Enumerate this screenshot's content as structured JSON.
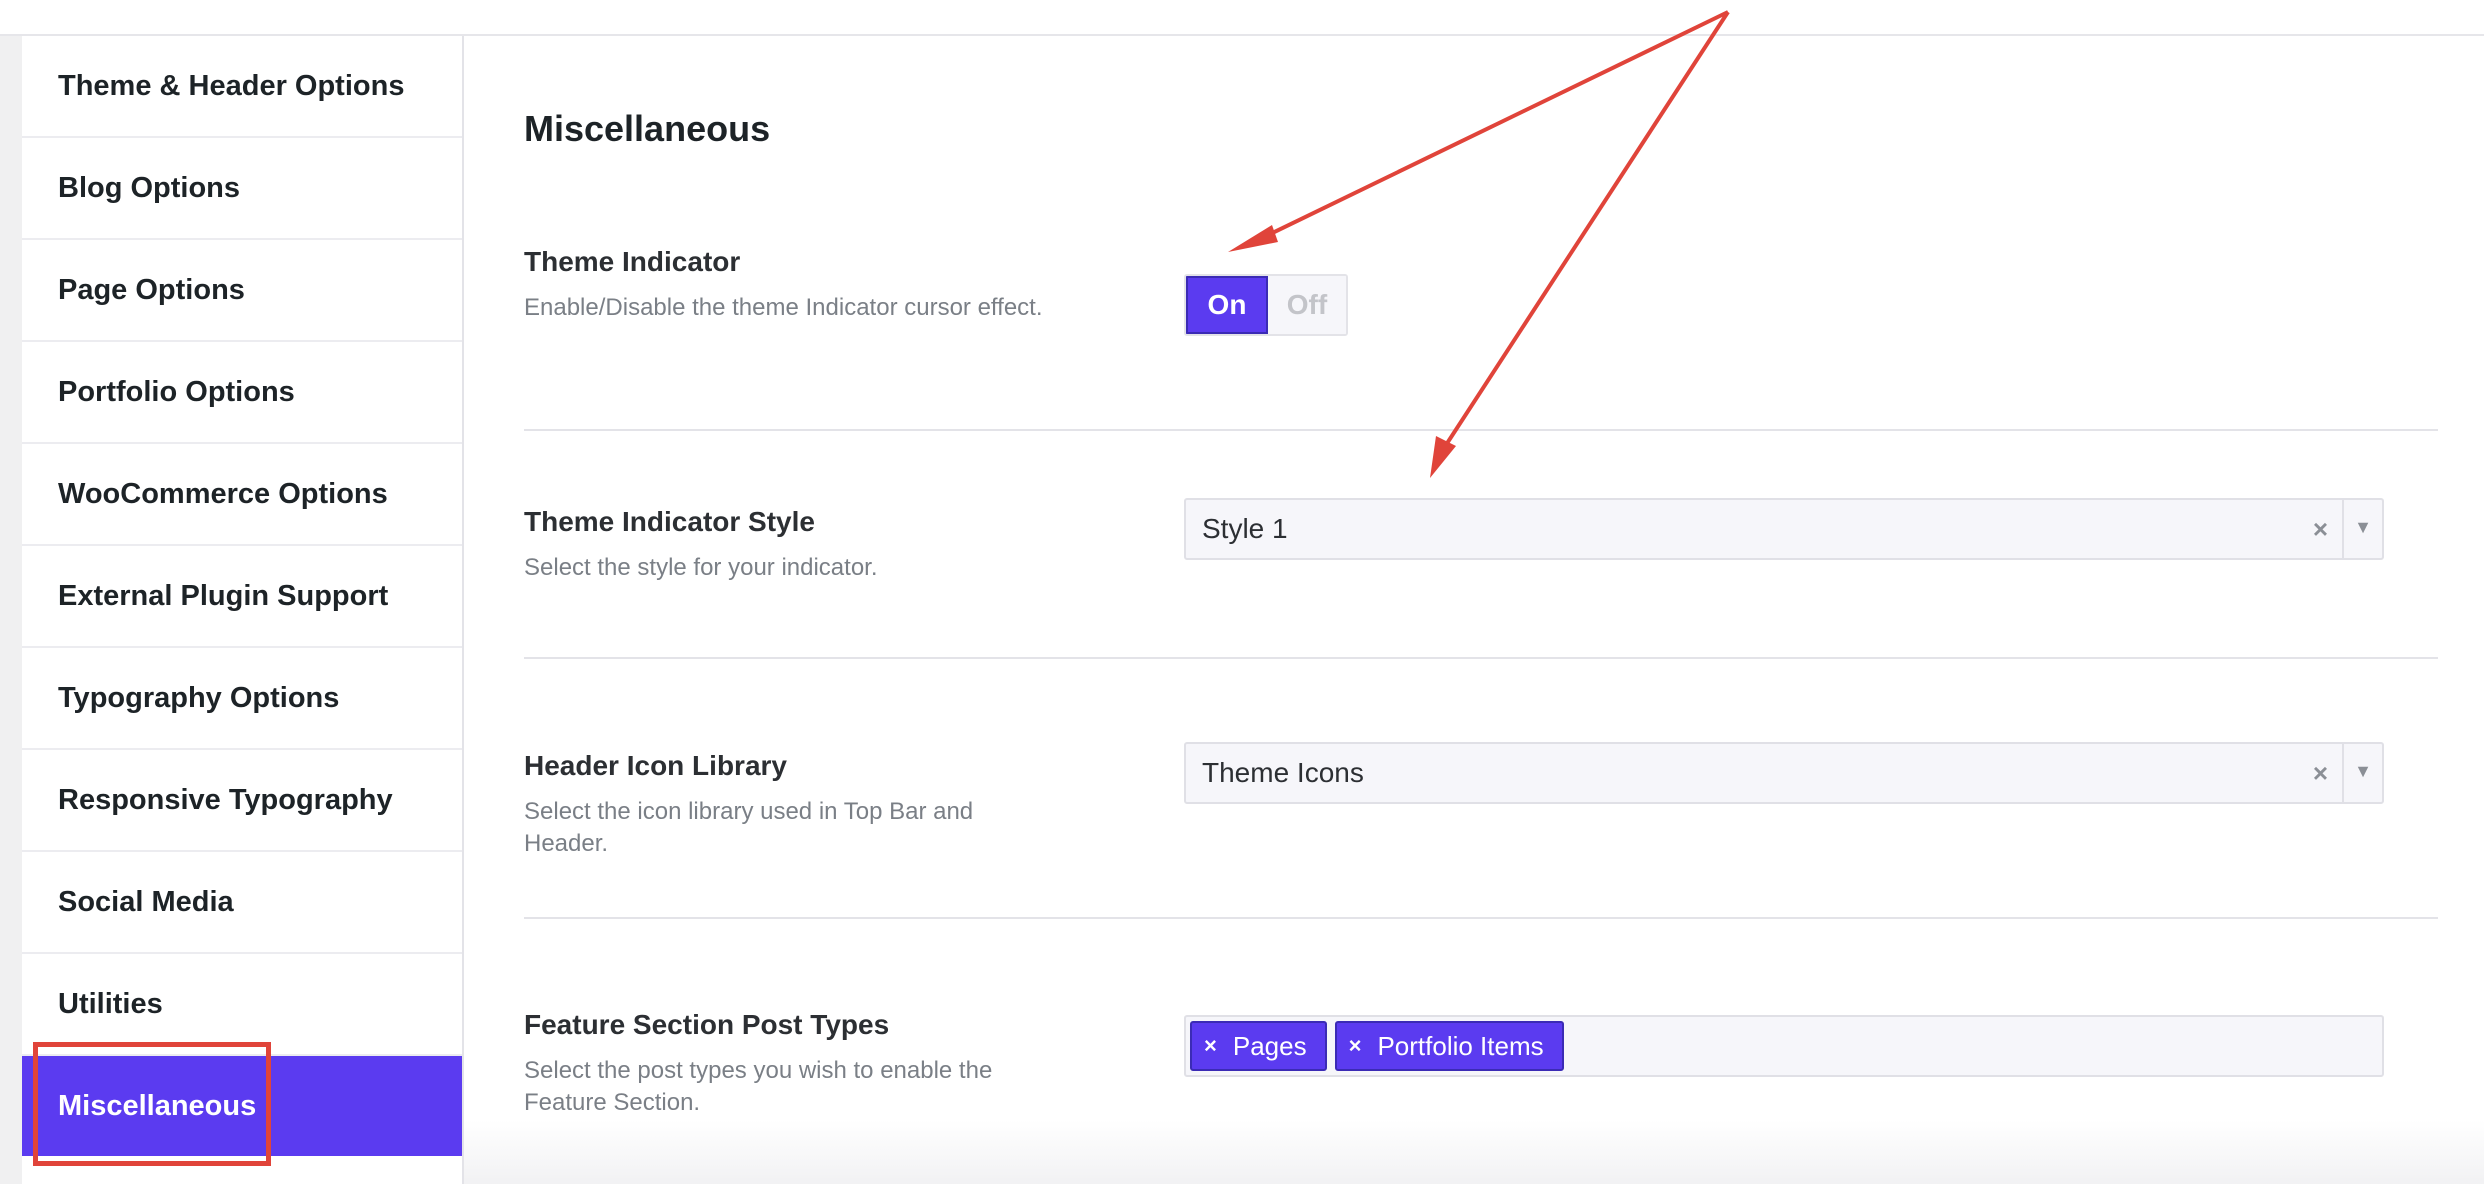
{
  "sidebar": {
    "items": [
      {
        "label": "Theme & Header Options"
      },
      {
        "label": "Blog Options"
      },
      {
        "label": "Page Options"
      },
      {
        "label": "Portfolio Options"
      },
      {
        "label": "WooCommerce Options"
      },
      {
        "label": "External Plugin Support"
      },
      {
        "label": "Typography Options"
      },
      {
        "label": "Responsive Typography"
      },
      {
        "label": "Social Media"
      },
      {
        "label": "Utilities"
      },
      {
        "label": "Miscellaneous",
        "active": true
      }
    ]
  },
  "main": {
    "title": "Miscellaneous",
    "settings": {
      "theme_indicator": {
        "label": "Theme Indicator",
        "description": "Enable/Disable the theme Indicator cursor effect.",
        "on_label": "On",
        "off_label": "Off",
        "value": "On"
      },
      "indicator_style": {
        "label": "Theme Indicator Style",
        "description": "Select the style for your indicator.",
        "value": "Style 1",
        "clear_icon": "×",
        "arrow_icon": "▼"
      },
      "icon_library": {
        "label": "Header Icon Library",
        "description": "Select the icon library used in Top Bar and Header.",
        "value": "Theme Icons",
        "clear_icon": "×",
        "arrow_icon": "▼"
      },
      "feature_section": {
        "label": "Feature Section Post Types",
        "description": "Select the post types you wish to enable the Feature Section.",
        "tags": [
          {
            "label": "Pages",
            "remove_icon": "×"
          },
          {
            "label": "Portfolio Items",
            "remove_icon": "×"
          }
        ]
      }
    }
  },
  "colors": {
    "accent": "#5b3bf0",
    "annotation": "#e0443a",
    "muted_text": "#7a7f86"
  }
}
